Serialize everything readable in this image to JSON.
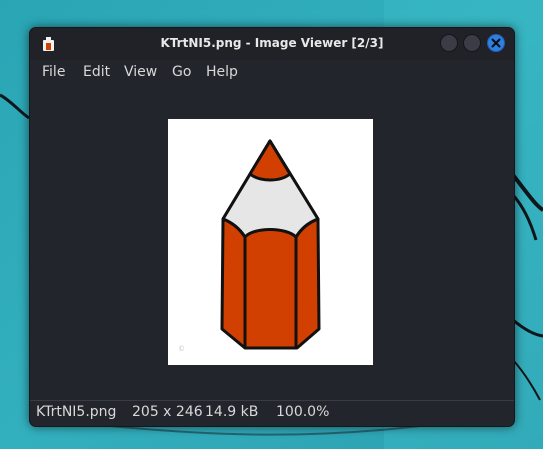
{
  "window": {
    "title": "KTrtNI5.png - Image Viewer [2/3]"
  },
  "menu": {
    "items": [
      "File",
      "Edit",
      "View",
      "Go",
      "Help"
    ]
  },
  "image": {
    "subject": "pencil-icon",
    "watermark_text": "©"
  },
  "status": {
    "filename": "KTrtNI5.png",
    "dimensions": "205 x 246",
    "filesize": "14.9 kB",
    "zoom": "100.0%"
  },
  "colors": {
    "pencil_body": "#d14000",
    "pencil_wood": "#e6e6e6",
    "window_bg": "#23252c",
    "close_button": "#2f7fe0",
    "wallpaper": "#35b3c1"
  },
  "icons": {
    "app": "image-viewer-icon",
    "close": "close-icon"
  }
}
